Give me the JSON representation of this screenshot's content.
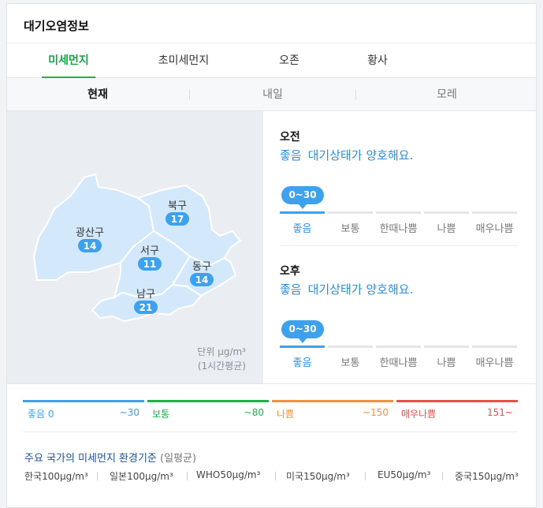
{
  "header": {
    "title": "대기오염정보"
  },
  "tabs": [
    {
      "label": "미세먼지",
      "active": true
    },
    {
      "label": "초미세먼지",
      "active": false
    },
    {
      "label": "오존",
      "active": false
    },
    {
      "label": "황사",
      "active": false
    }
  ],
  "day_tabs": [
    {
      "label": "현재",
      "active": true
    },
    {
      "label": "내일",
      "active": false
    },
    {
      "label": "모레",
      "active": false
    }
  ],
  "map": {
    "regions": [
      {
        "name": "광산구",
        "value": "14"
      },
      {
        "name": "북구",
        "value": "17"
      },
      {
        "name": "서구",
        "value": "11"
      },
      {
        "name": "동구",
        "value": "14"
      },
      {
        "name": "남구",
        "value": "21"
      }
    ],
    "unit_line1": "단위 μg/m³",
    "unit_line2": "(1시간평균)"
  },
  "forecast": {
    "am": {
      "label": "오전",
      "grade": "좋음",
      "message": "대기상태가 양호해요.",
      "range": "0~30"
    },
    "pm": {
      "label": "오후",
      "grade": "좋음",
      "message": "대기상태가 양호해요.",
      "range": "0~30"
    },
    "scale": [
      "좋음",
      "보통",
      "한때나쁨",
      "나쁨",
      "매우나쁨"
    ],
    "active_index": 0
  },
  "legend": [
    {
      "name": "좋음 0",
      "range": "~30",
      "color": "#3da1ee"
    },
    {
      "name": "보통",
      "range": "~80",
      "color": "#19b24b"
    },
    {
      "name": "나쁨",
      "range": "~150",
      "color": "#f5903d"
    },
    {
      "name": "매우나쁨",
      "range": "151~",
      "color": "#e8504b"
    }
  ],
  "standards": {
    "title": "주요 국가의 미세먼지 환경기준",
    "subtitle": "(일평균)",
    "items": [
      "한국100μg/m³",
      "일본100μg/m³",
      "WHO50μg/m³",
      "미국150μg/m³",
      "EU50μg/m³",
      "중국150μg/m³"
    ]
  },
  "colors": {
    "accent_green": "#19b24b",
    "good_blue": "#3da1ee",
    "map_fill": "#d3e8fb"
  }
}
